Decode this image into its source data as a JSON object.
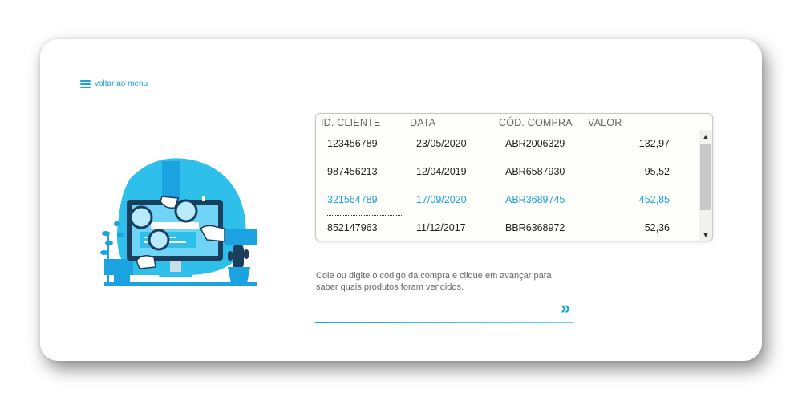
{
  "nav": {
    "menu_label": "voltar ao menu",
    "menu_icon": "hamburger-icon"
  },
  "colors": {
    "accent": "#1aa3e0",
    "illustration_blob": "#2ec0ea",
    "card_bg": "#ffffff"
  },
  "table": {
    "headers": [
      "ID. CLIENTE",
      "DATA",
      "CÓD. COMPRA",
      "VALOR"
    ],
    "selected_row": 2,
    "rows": [
      {
        "id": "123456789",
        "date": "23/05/2020",
        "code": "ABR2006329",
        "value": "132,97"
      },
      {
        "id": "987456213",
        "date": "12/04/2019",
        "code": "ABR6587930",
        "value": "95,52"
      },
      {
        "id": "321564789",
        "date": "17/09/2020",
        "code": "ABR3689745",
        "value": "452,85"
      },
      {
        "id": "852147963",
        "date": "11/12/2017",
        "code": "BBR6368972",
        "value": "52,36"
      }
    ]
  },
  "hint": {
    "text": "Cole ou digite o código da compra e clique em avançar  para saber quais produtos foram vendidos."
  },
  "search": {
    "value": "",
    "placeholder": "",
    "advance_icon": "double-chevron-right-icon",
    "advance_glyph": "»"
  }
}
